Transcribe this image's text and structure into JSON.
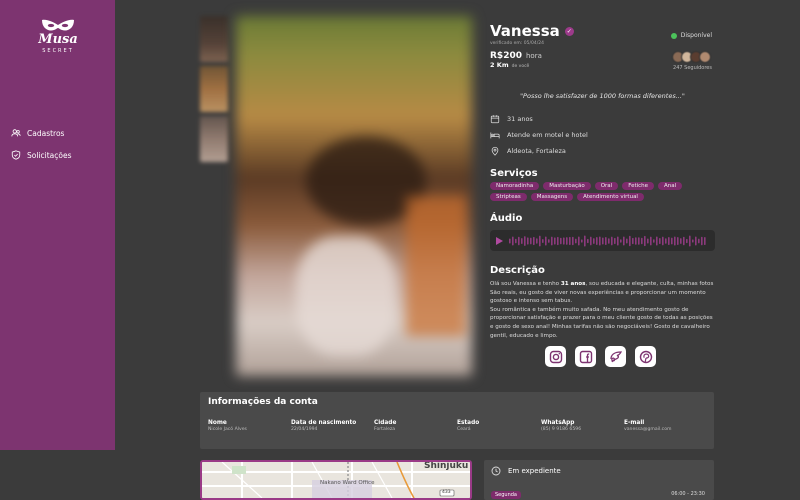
{
  "brand": {
    "name": "Musa",
    "sub": "SECRET"
  },
  "sidebar": {
    "items": [
      {
        "label": "Cadastros",
        "icon": "users-icon"
      },
      {
        "label": "Solicitações",
        "icon": "shield-check-icon"
      }
    ]
  },
  "profile": {
    "name": "Vanessa",
    "verified_text": "verificado em: 05/04/24",
    "price": "R$200",
    "price_unit": "hora",
    "distance": "2 Km",
    "distance_sub": "de você",
    "status": "Disponível",
    "followers": "247 Seguidores",
    "quote": "\"Posso lhe satisfazer de 1000 formas diferentes...\"",
    "age": "31 anos",
    "attends": "Atende em motel e hotel",
    "location": "Aldeota, Fortaleza"
  },
  "services": {
    "title": "Serviços",
    "tags": [
      "Namoradinha",
      "Masturbação",
      "Oral",
      "Fetiche",
      "Anal",
      "Stripteas",
      "Massagens",
      "Atendimento virtual"
    ]
  },
  "audio": {
    "title": "Áudio"
  },
  "description": {
    "title": "Descrição",
    "intro": "Olá sou Vanessa e tenho ",
    "age_bold": "31 anos",
    "text": ", sou educada e elegante, culta, minhas fotos São reais, eu gosto de viver novas experiências e proporcionar um momento gostoso e intenso sem tabus.",
    "text2": "Sou romântica e também muito safada. No meu atendimento gosto de proporcionar satisfação e prazer para o meu cliente gosto de todas as posições e gosto de sexo anal! Minhas tarifas não são negociáveis! Gosto de cavalheiro gentil, educado e limpo."
  },
  "socials": [
    "instagram-icon",
    "facebook-icon",
    "wings-icon",
    "pinterest-icon"
  ],
  "account": {
    "title": "Informações da conta",
    "fields": [
      {
        "label": "Nome",
        "value": "Nicole Jacó Alves"
      },
      {
        "label": "Data de nascimento",
        "value": "22/04/1994"
      },
      {
        "label": "Cidade",
        "value": "Fortaleza"
      },
      {
        "label": "Estado",
        "value": "Ceará"
      },
      {
        "label": "WhatsApp",
        "value": "(85) 9 9186 6596"
      },
      {
        "label": "E-mail",
        "value": "vanessa@gmail.com"
      }
    ]
  },
  "map": {
    "district": "Nakano Ward Office",
    "place": "Shinjuku",
    "road_sign": "433"
  },
  "schedule": {
    "title": "Em expediente",
    "day": "Segunda",
    "hours": "06:00 - 23:30"
  },
  "colors": {
    "sidebar": "#7d3470",
    "accent": "#9c3a8a",
    "background": "#3b3b3b",
    "card": "#4a4a4a",
    "status": "#4cc35b"
  }
}
